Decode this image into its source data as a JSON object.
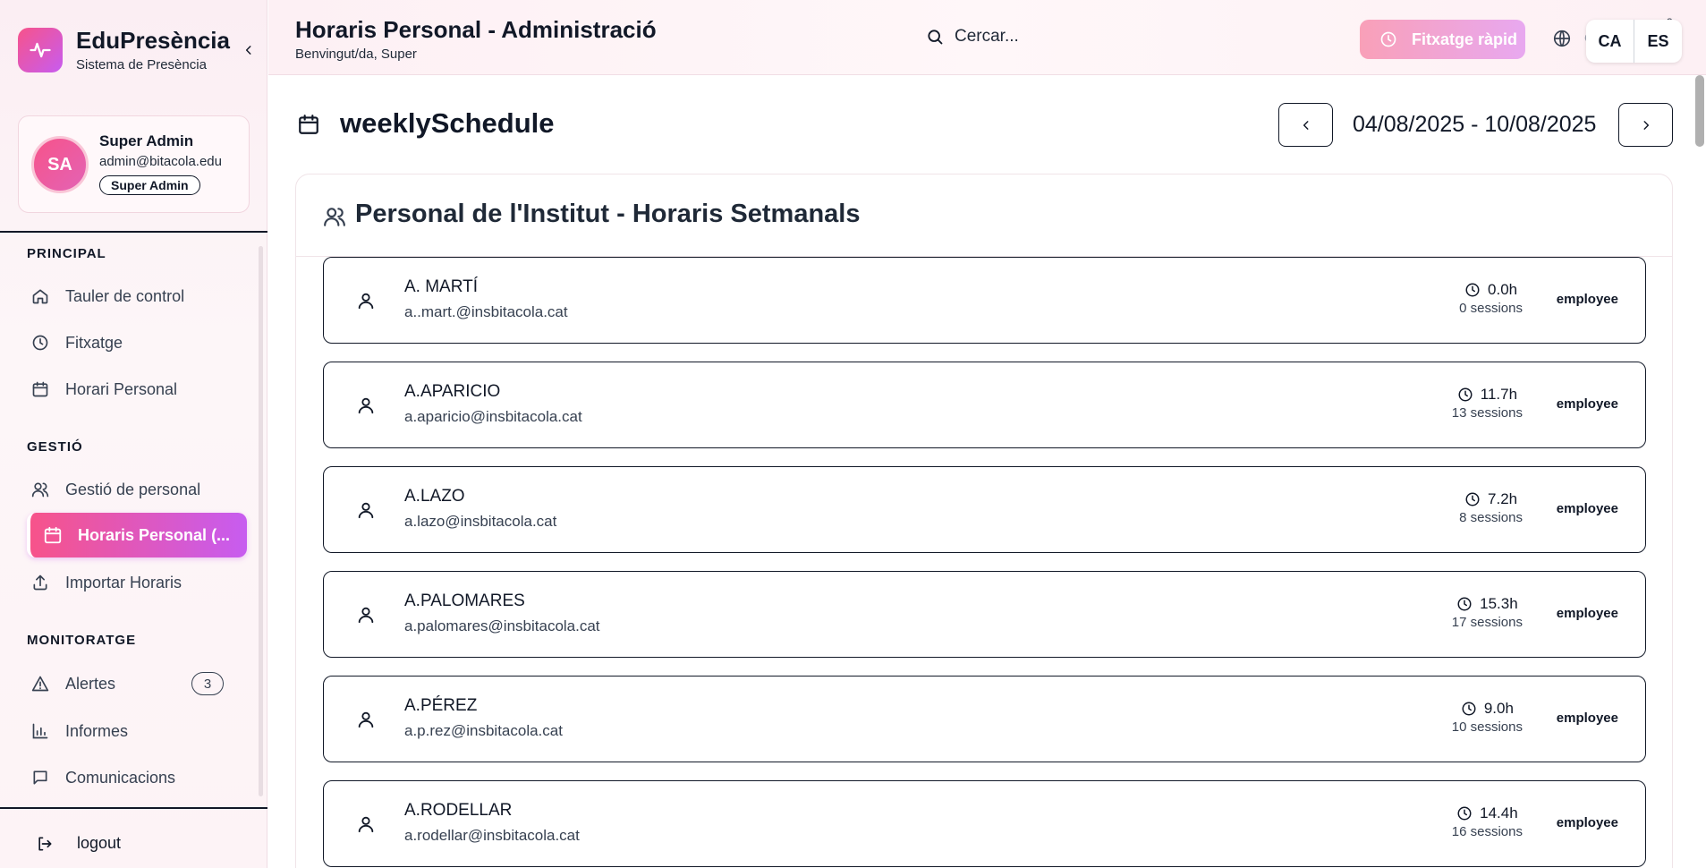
{
  "brand": {
    "title": "EduPresència",
    "subtitle": "Sistema de Presència"
  },
  "user": {
    "initials": "SA",
    "name": "Super Admin",
    "email": "admin@bitacola.edu",
    "role": "Super Admin"
  },
  "sidebar": {
    "sections": [
      {
        "label": "PRINCIPAL"
      },
      {
        "label": "GESTIÓ"
      },
      {
        "label": "MONITORATGE"
      }
    ],
    "items": [
      {
        "label": "Tauler de control",
        "icon": "home-icon"
      },
      {
        "label": "Fitxatge",
        "icon": "clock-icon"
      },
      {
        "label": "Horari Personal",
        "icon": "calendar-icon"
      },
      {
        "label": "Gestió de personal",
        "icon": "users-icon"
      },
      {
        "label": "Horaris Personal (...",
        "icon": "calendar-icon",
        "active": true
      },
      {
        "label": "Importar Horaris",
        "icon": "upload-icon"
      },
      {
        "label": "Alertes",
        "icon": "alert-triangle-icon",
        "badge": "3"
      },
      {
        "label": "Informes",
        "icon": "bar-chart-icon"
      },
      {
        "label": "Comunicacions",
        "icon": "message-icon"
      }
    ],
    "logout": "logout"
  },
  "header": {
    "title": "Horaris Personal - Administració",
    "welcome": "Benvingut/da, Super",
    "search_placeholder": "Cercar...",
    "quick_clock": "Fitxatge ràpid",
    "lang_ghost": "CA",
    "notification_count": "3",
    "languages": [
      "CA",
      "ES"
    ]
  },
  "week": {
    "title": "weeklySchedule",
    "range": "04/08/2025 - 10/08/2025"
  },
  "card": {
    "title": "Personal de l'Institut - Horaris Setmanals"
  },
  "staff": [
    {
      "name": "A. MARTÍ",
      "email": "a..mart.@insbitacola.cat",
      "hours": "0.0h",
      "sessions": "0 sessions",
      "role": "employee"
    },
    {
      "name": "A.APARICIO",
      "email": "a.aparicio@insbitacola.cat",
      "hours": "11.7h",
      "sessions": "13 sessions",
      "role": "employee"
    },
    {
      "name": "A.LAZO",
      "email": "a.lazo@insbitacola.cat",
      "hours": "7.2h",
      "sessions": "8 sessions",
      "role": "employee"
    },
    {
      "name": "A.PALOMARES",
      "email": "a.palomares@insbitacola.cat",
      "hours": "15.3h",
      "sessions": "17 sessions",
      "role": "employee"
    },
    {
      "name": "A.PÉREZ",
      "email": "a.p.rez@insbitacola.cat",
      "hours": "9.0h",
      "sessions": "10 sessions",
      "role": "employee"
    },
    {
      "name": "A.RODELLAR",
      "email": "a.rodellar@insbitacola.cat",
      "hours": "14.4h",
      "sessions": "16 sessions",
      "role": "employee"
    }
  ]
}
